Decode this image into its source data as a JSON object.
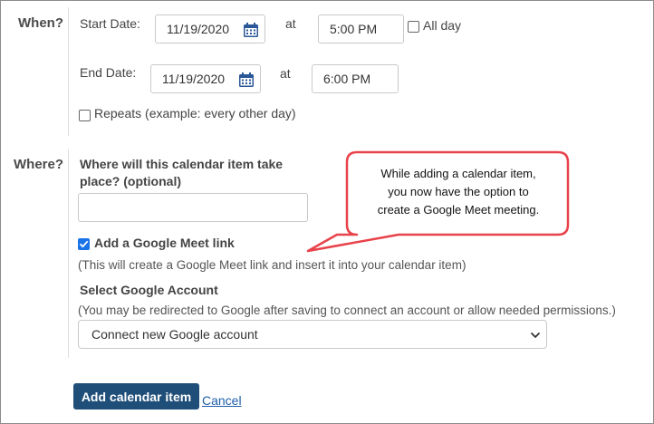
{
  "when": {
    "section_label": "When?",
    "start_label": "Start Date:",
    "start_date": "11/19/2020",
    "start_at": "at",
    "start_time": "5:00 PM",
    "all_day_label": "All day",
    "end_label": "End Date:",
    "end_date": "11/19/2020",
    "end_at": "at",
    "end_time": "6:00 PM",
    "repeats_label": "Repeats (example: every other day)"
  },
  "where": {
    "section_label": "Where?",
    "question_line1": "Where will this calendar item take",
    "question_line2": "place? (optional)",
    "location_value": "",
    "meet_label": "Add a Google Meet link",
    "meet_checked": true,
    "meet_help": "(This will create a Google Meet link and insert it into your calendar item)",
    "account_label": "Select Google Account",
    "account_help": "(You may be redirected to Google after saving to connect an account or allow needed permissions.)",
    "account_selected": "Connect new Google account"
  },
  "actions": {
    "add_label": "Add calendar item",
    "cancel_label": "Cancel"
  },
  "callout": {
    "line1": "While adding a calendar item,",
    "line2": "you now have the option to",
    "line3": "create a Google Meet meeting."
  },
  "icons": {
    "calendar": "calendar-icon",
    "check": "checkmark-icon",
    "dropdown": "chevron-down-icon"
  },
  "colors": {
    "primary_button": "#1f4e79",
    "link": "#1f5fa8",
    "checkbox_checked": "#1a73e8",
    "callout_border": "#e8424a"
  }
}
